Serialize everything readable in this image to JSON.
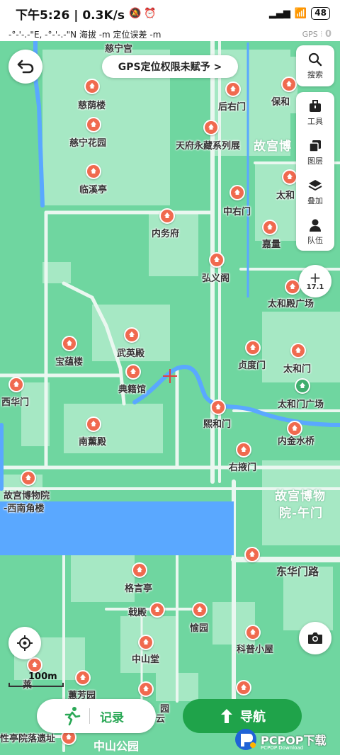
{
  "status_bar": {
    "time_speed": "下午5:26 | 0.3K/s",
    "battery": "48"
  },
  "info_bar": {
    "coords": "-°-'-.-\"E, -°-'-.-\"N  海拔 -m   定位误差 -m",
    "gps_label": "GPS",
    "gps_count": "0"
  },
  "gps_banner": "GPS定位权限未赋予 >",
  "side_panel": {
    "search": "搜索",
    "tools": "工具",
    "layers": "图层",
    "overlay": "叠加",
    "team": "队伍"
  },
  "zoom_level": "17.1",
  "scale_text": "100m",
  "record_label": "记录",
  "nav_label": "导航",
  "watermark": "PCPOP下载",
  "watermark_sub": "PCPOP Download",
  "map_labels": {
    "cining_palace": "慈宁宫",
    "ciyin_lou": "慈荫楼",
    "houyou_men": "后右门",
    "baohe": "保和",
    "cining_garden": "慈宁花园",
    "tianfu": "天府永藏系列展",
    "palace_museum_n": "故宫博",
    "linxi_ting": "临溪亭",
    "taihe_n": "太和",
    "zhongyou_men": "中右门",
    "neiwu_fu": "内务府",
    "jialiang": "嘉量",
    "hongyi_ge": "弘义阁",
    "taihe_square": "太和殿广场",
    "baoyun_lou": "宝蕴楼",
    "wuying_dian": "武英殿",
    "zhendu_men": "贞度门",
    "taihe_men": "太和门",
    "dianji_guan": "典籍馆",
    "xihua_men": "西华门",
    "taihemen_square": "太和门广场",
    "xihe_men": "熙和门",
    "nanxun_dian": "南薰殿",
    "neijinshui": "内金水桥",
    "youye_men": "右掖门",
    "museum_sw_1": "故宫博物院",
    "museum_sw_2": "-西南角楼",
    "museum_wumen_1": "故宫博物",
    "museum_wumen_2": "院-午门",
    "donghuamen_road": "东华门路",
    "geyan_ting": "格言亭",
    "ji_dian": "戟殿",
    "yu_yuan": "愉园",
    "zhongshan_tang": "中山堂",
    "kepu_xiaowu": "科普小屋",
    "huifang_yuan": "蕙芳园",
    "yuan": "园",
    "yun": "云",
    "ting_site": "性亭院落遗址",
    "zhongshan_park": "中山公园",
    "lai": "莱"
  },
  "colors": {
    "map_base": "#6fd6a0",
    "block": "#a6e8c4",
    "road": "#eaf7f0",
    "water": "#5aa8ff",
    "poi": "#f06a4f",
    "nav_green": "#1fa34a"
  }
}
